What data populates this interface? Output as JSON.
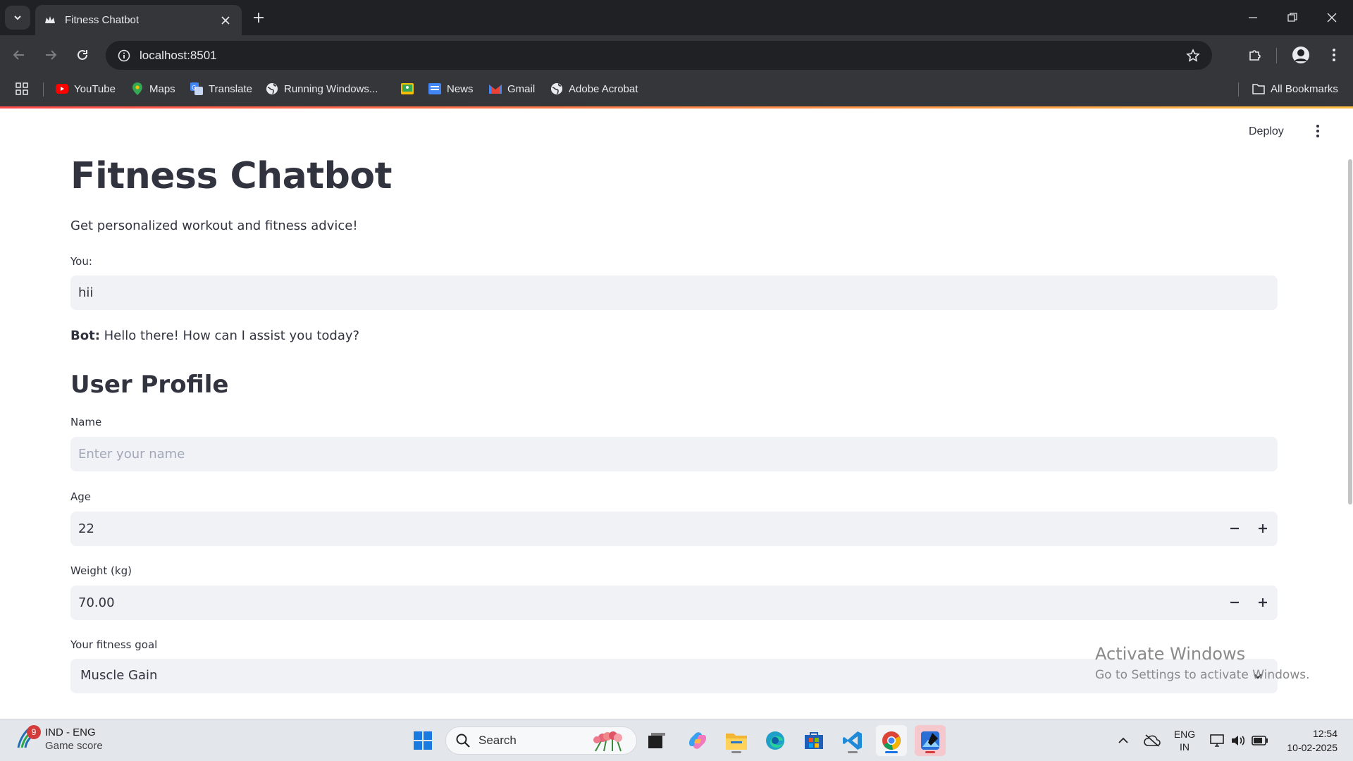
{
  "browser": {
    "tab_title": "Fitness Chatbot",
    "url": "localhost:8501",
    "bookmarks": [
      {
        "label": "YouTube",
        "icon": "youtube-icon"
      },
      {
        "label": "Maps",
        "icon": "maps-icon"
      },
      {
        "label": "Translate",
        "icon": "translate-icon"
      },
      {
        "label": "Running Windows...",
        "icon": "globe-icon"
      },
      {
        "label": "",
        "icon": "classroom-icon"
      },
      {
        "label": "News",
        "icon": "news-icon"
      },
      {
        "label": "Gmail",
        "icon": "gmail-icon"
      },
      {
        "label": "Adobe Acrobat",
        "icon": "globe-icon"
      }
    ],
    "all_bookmarks": "All Bookmarks"
  },
  "app": {
    "deploy_label": "Deploy",
    "title": "Fitness Chatbot",
    "subtitle": "Get personalized workout and fitness advice!",
    "chat": {
      "input_label": "You:",
      "input_value": "hii",
      "bot_prefix": "Bot:",
      "bot_reply": "Hello there! How can I assist you today?"
    },
    "profile": {
      "heading": "User Profile",
      "name_label": "Name",
      "name_placeholder": "Enter your name",
      "age_label": "Age",
      "age_value": "22",
      "weight_label": "Weight (kg)",
      "weight_value": "70.00",
      "goal_label": "Your fitness goal",
      "goal_value": "Muscle Gain"
    }
  },
  "watermark": {
    "line1": "Activate Windows",
    "line2": "Go to Settings to activate Windows."
  },
  "taskbar": {
    "widget_badge": "9",
    "widget_line1": "IND - ENG",
    "widget_line2": "Game score",
    "search_label": "Search",
    "lang_line1": "ENG",
    "lang_line2": "IN",
    "time": "12:54",
    "date": "10-02-2025"
  },
  "colors": {
    "chrome_dark": "#202124",
    "chrome_toolbar": "#35363a",
    "streamlit_text": "#31333f",
    "input_bg": "#f0f2f6",
    "accent_red": "#ff4b4b"
  }
}
